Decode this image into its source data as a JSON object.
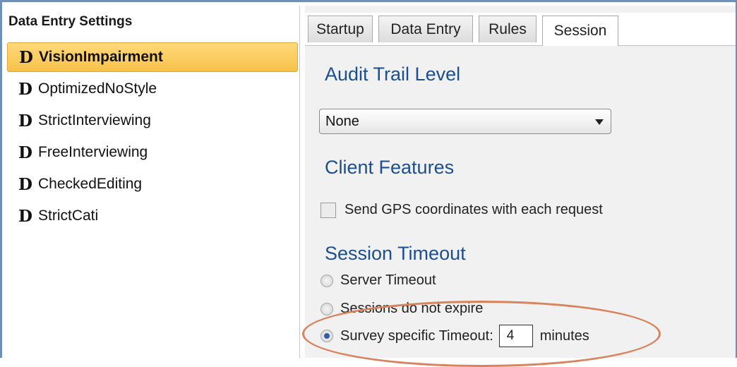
{
  "left": {
    "header": "Data Entry Settings",
    "items": [
      {
        "mark": "D",
        "label": "VisionImpairment",
        "selected": true
      },
      {
        "mark": "D",
        "label": "OptimizedNoStyle"
      },
      {
        "mark": "D",
        "label": "StrictInterviewing"
      },
      {
        "mark": "D",
        "label": "FreeInterviewing"
      },
      {
        "mark": "D",
        "label": "CheckedEditing"
      },
      {
        "mark": "D",
        "label": "StrictCati"
      }
    ]
  },
  "tabs": [
    {
      "label": "Startup"
    },
    {
      "label": "Data Entry"
    },
    {
      "label": "Rules"
    },
    {
      "label": "Session",
      "active": true
    }
  ],
  "session": {
    "audit_title": "Audit Trail Level",
    "audit_value": "None",
    "client_title": "Client Features",
    "gps_label": "Send GPS coordinates with each request",
    "timeout_title": "Session Timeout",
    "radio_server": "Server Timeout",
    "radio_never": "Sessions do not expire",
    "radio_survey": "Survey specific Timeout:",
    "timeout_value": "4",
    "timeout_unit": "minutes"
  },
  "colors": {
    "accent_title": "#1c4f8f",
    "selected_bg": "#f8c24a",
    "highlight": "#d9825c",
    "frame": "#6f8fb8"
  }
}
